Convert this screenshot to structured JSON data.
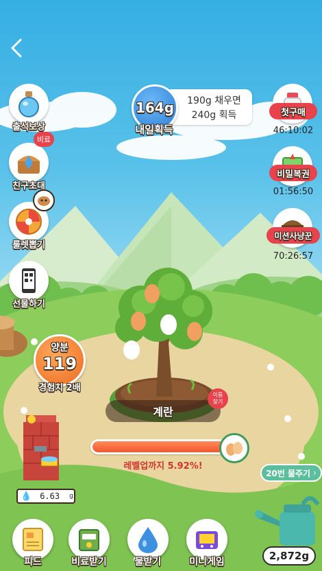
{
  "header": {
    "back_icon": "chevron-left-icon"
  },
  "daily_reward": {
    "amount": "164g",
    "caption": "내일획득",
    "info_line1": "190g 채우면",
    "info_line2": "240g 획득"
  },
  "left_menu": [
    {
      "label": "출석보상",
      "icon": "potion-bottle-icon"
    },
    {
      "label": "친구초대",
      "icon": "treasure-chest-icon",
      "badge": "비료"
    },
    {
      "label": "룰렛뽑기",
      "icon": "roulette-wheel-icon"
    },
    {
      "label": "선물하기",
      "icon": "qr-phone-icon"
    }
  ],
  "right_menu": [
    {
      "label": "첫구매",
      "timer": "46:10:02",
      "icon": "milk-bottle-icon"
    },
    {
      "label": "비밀복권",
      "timer": "01:56:50",
      "icon": "lottery-ticket-icon"
    },
    {
      "label": "미션사냥꾼",
      "timer": "70:26:57",
      "icon": "hunter-character-icon"
    }
  ],
  "nutrient": {
    "title": "양분",
    "value": "119",
    "caption": "경험치 2배"
  },
  "tree": {
    "name": "계란",
    "find_name_badge": "이름\n찾기"
  },
  "progress": {
    "fraction": 0.9408,
    "label": "레벨업까지 5.92%!"
  },
  "water_tank": {
    "value": "6.63",
    "unit": "g"
  },
  "water_action": {
    "label": "20번 물주기",
    "icon": "chevron-right-icon"
  },
  "watering_can": {
    "amount": "2,872g"
  },
  "bottom_nav": [
    {
      "label": "피드",
      "icon": "feed-document-icon"
    },
    {
      "label": "비료받기",
      "icon": "fertilizer-bag-icon"
    },
    {
      "label": "물받기",
      "icon": "water-drop-icon"
    },
    {
      "label": "미니게임",
      "icon": "game-console-icon"
    }
  ],
  "colors": {
    "accent_red": "#e8424c",
    "progress_orange": "#ff6a3a",
    "water_blue": "#3d8fe0",
    "nutrient_orange": "#f07a2c"
  }
}
